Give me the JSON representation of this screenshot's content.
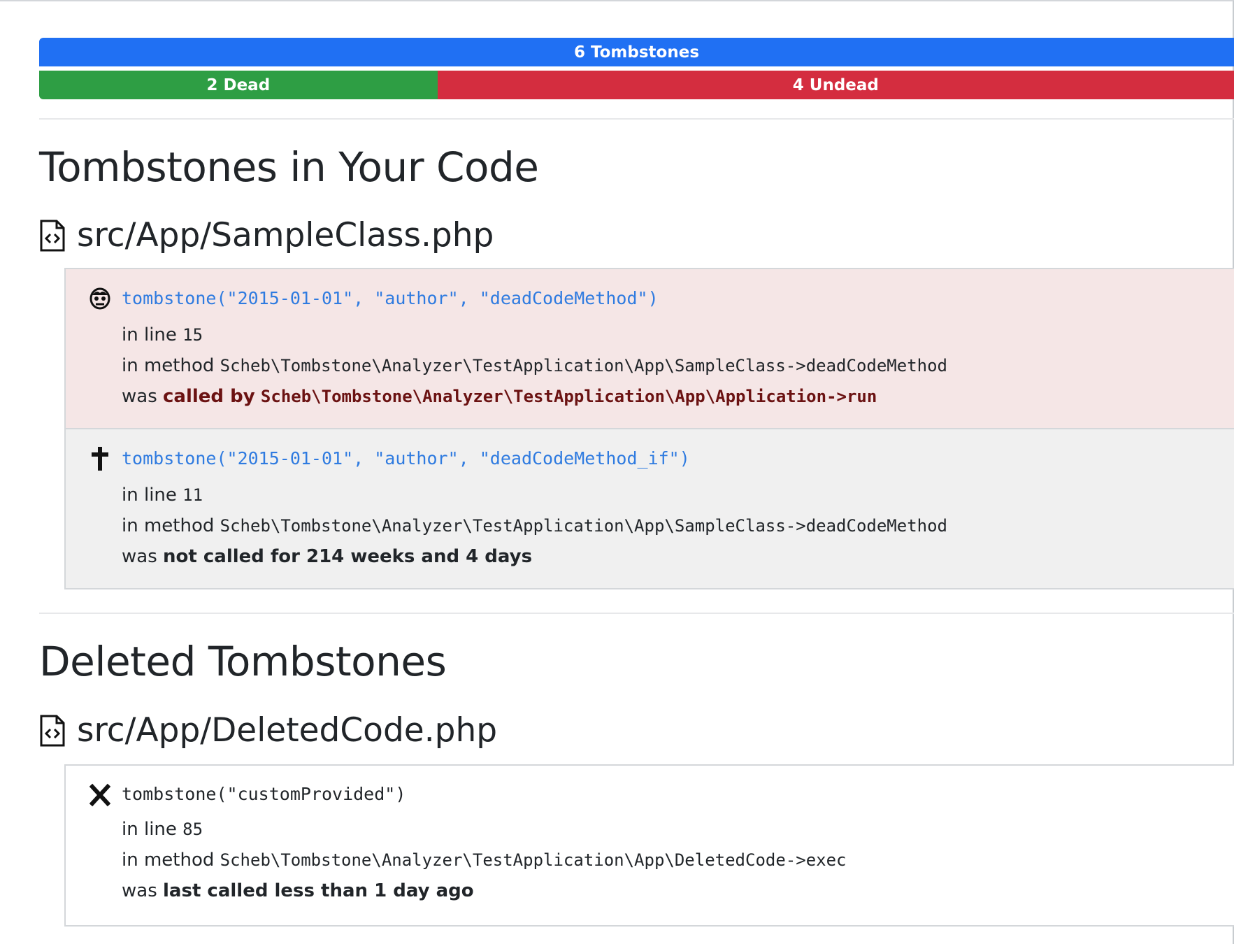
{
  "summary": {
    "total_label": "6 Tombstones",
    "dead_label": "2 Dead",
    "undead_label": "4 Undead",
    "total": 6,
    "dead": 2,
    "undead": 4,
    "colors": {
      "total": "#2070f3",
      "dead": "#2e9e44",
      "undead": "#d42d3f"
    }
  },
  "sections": {
    "active": {
      "title": "Tombstones in Your Code",
      "file": {
        "icon": "file-code-icon",
        "path": "src/App/SampleClass.php",
        "items": [
          {
            "status": "undead",
            "icon": "zombie-icon",
            "call": "tombstone(\"2015-01-01\", \"author\", \"deadCodeMethod\")",
            "line_prefix": "in line",
            "line": "15",
            "method_prefix": "in method",
            "method": "Scheb\\Tombstone\\Analyzer\\TestApplication\\App\\SampleClass->deadCodeMethod",
            "was_prefix": "was",
            "was_label": "called by",
            "was_detail": "Scheb\\Tombstone\\Analyzer\\TestApplication\\App\\Application->run"
          },
          {
            "status": "dead",
            "icon": "cross-icon",
            "call": "tombstone(\"2015-01-01\", \"author\", \"deadCodeMethod_if\")",
            "line_prefix": "in line",
            "line": "11",
            "method_prefix": "in method",
            "method": "Scheb\\Tombstone\\Analyzer\\TestApplication\\App\\SampleClass->deadCodeMethod",
            "was_prefix": "was",
            "was_label": "not called for 214 weeks and 4 days"
          }
        ]
      }
    },
    "deleted": {
      "title": "Deleted Tombstones",
      "file": {
        "icon": "file-code-icon",
        "path": "src/App/DeletedCode.php",
        "items": [
          {
            "status": "deleted",
            "icon": "x-mark-icon",
            "call": "tombstone(\"customProvided\")",
            "line_prefix": "in line",
            "line": "85",
            "method_prefix": "in method",
            "method": "Scheb\\Tombstone\\Analyzer\\TestApplication\\App\\DeletedCode->exec",
            "was_prefix": "was",
            "was_label": "last called less than 1 day ago"
          }
        ]
      }
    }
  }
}
